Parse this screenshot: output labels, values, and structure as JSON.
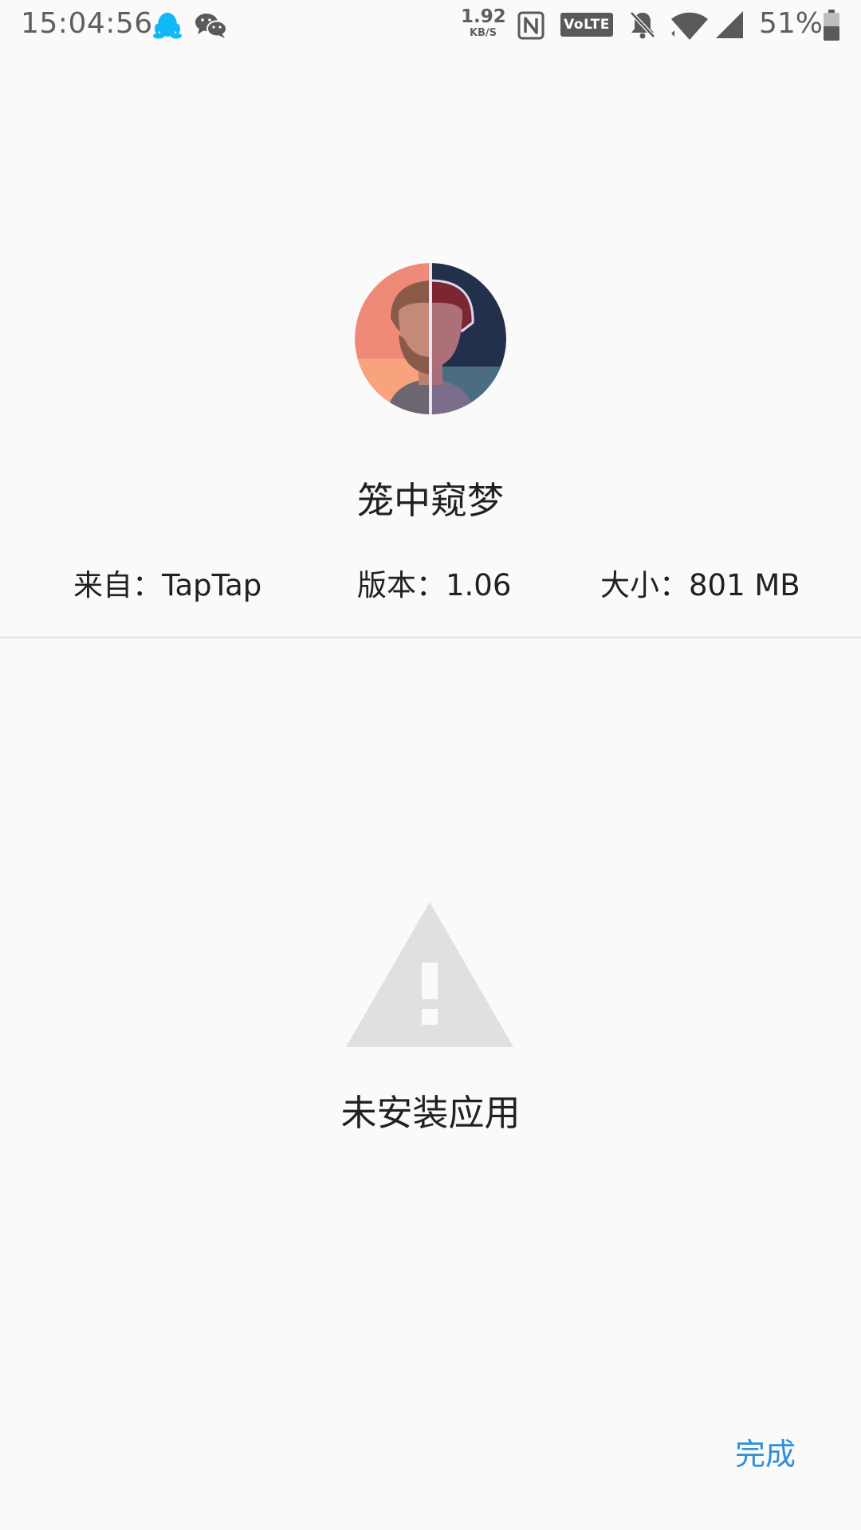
{
  "status_bar": {
    "time": "15:04:56",
    "net_speed_value": "1.92",
    "net_speed_unit": "KB/S",
    "volte_label": "VoLTE",
    "battery_percent": "51%",
    "icons": [
      "qq-icon",
      "wechat-icon",
      "nfc-icon",
      "volte-icon",
      "mute-icon",
      "wifi-icon",
      "signal-icon",
      "battery-icon"
    ],
    "battery_level": 0.51
  },
  "app": {
    "name": "笼中窥梦",
    "icon": "app-icon",
    "source": "来自：TapTap",
    "version": "版本：1.06",
    "size": "大小：801 MB"
  },
  "result": {
    "icon": "warning-icon",
    "message": "未安装应用"
  },
  "actions": {
    "done_label": "完成"
  },
  "colors": {
    "background": "#fafafa",
    "accent": "#2f8fd8",
    "warning_icon": "#e0e0e0",
    "qq_icon": "#12b7f5"
  }
}
